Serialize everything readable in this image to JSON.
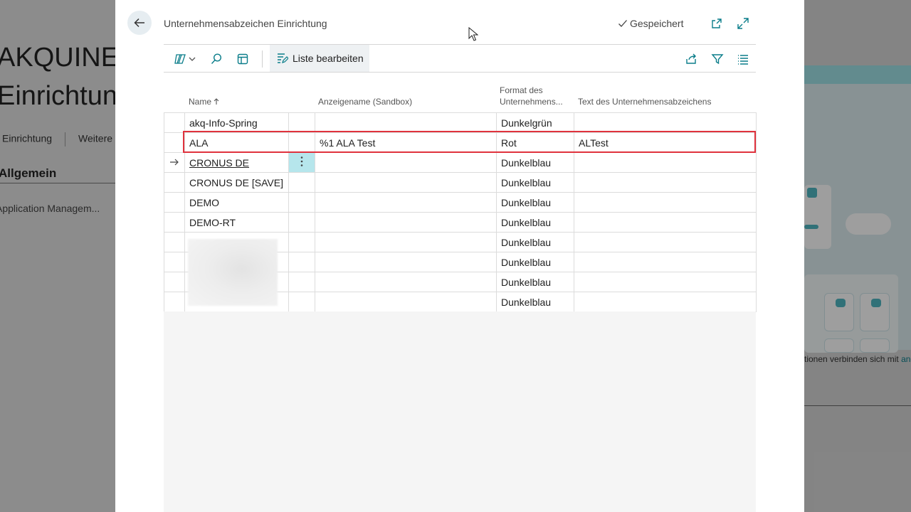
{
  "background": {
    "title_line1": "AKQUINET",
    "title_line2": "Einrichtung",
    "action_setup": "Einrichtung",
    "action_more": "Weitere",
    "section": "Allgemein",
    "field_label": "Application Managem...",
    "caption_text": "tionen verbinden sich mit ",
    "caption_link": "and"
  },
  "dialog": {
    "title": "Unternehmensabzeichen Einrichtung",
    "saved_label": "Gespeichert"
  },
  "toolbar": {
    "edit_list_label": "Liste bearbeiten"
  },
  "columns": {
    "name": "Name",
    "display_name": "Anzeigename (Sandbox)",
    "format_line1": "Format des",
    "format_line2": "Unternehmens...",
    "badge_text": "Text des Unternehmensabzeichens"
  },
  "rows": [
    {
      "name": "akq-Info-Spring",
      "display": "",
      "format": "Dunkelgrün",
      "text": ""
    },
    {
      "name": "ALA",
      "display": "%1 ALA Test",
      "format": "Rot",
      "text": "ALTest"
    },
    {
      "name": "CRONUS DE",
      "display": "",
      "format": "Dunkelblau",
      "text": ""
    },
    {
      "name": "CRONUS DE [SAVE]",
      "display": "",
      "format": "Dunkelblau",
      "text": ""
    },
    {
      "name": "DEMO",
      "display": "",
      "format": "Dunkelblau",
      "text": ""
    },
    {
      "name": "DEMO-RT",
      "display": "",
      "format": "Dunkelblau",
      "text": ""
    },
    {
      "name": "",
      "display": "",
      "format": "Dunkelblau",
      "text": ""
    },
    {
      "name": "",
      "display": "",
      "format": "Dunkelblau",
      "text": ""
    },
    {
      "name": "",
      "display": "",
      "format": "Dunkelblau",
      "text": ""
    },
    {
      "name": "",
      "display": "",
      "format": "Dunkelblau",
      "text": ""
    }
  ],
  "colors": {
    "accent": "#0a7d8a",
    "highlight_border": "#e0323d",
    "selected_cell": "#b6e6ec"
  }
}
